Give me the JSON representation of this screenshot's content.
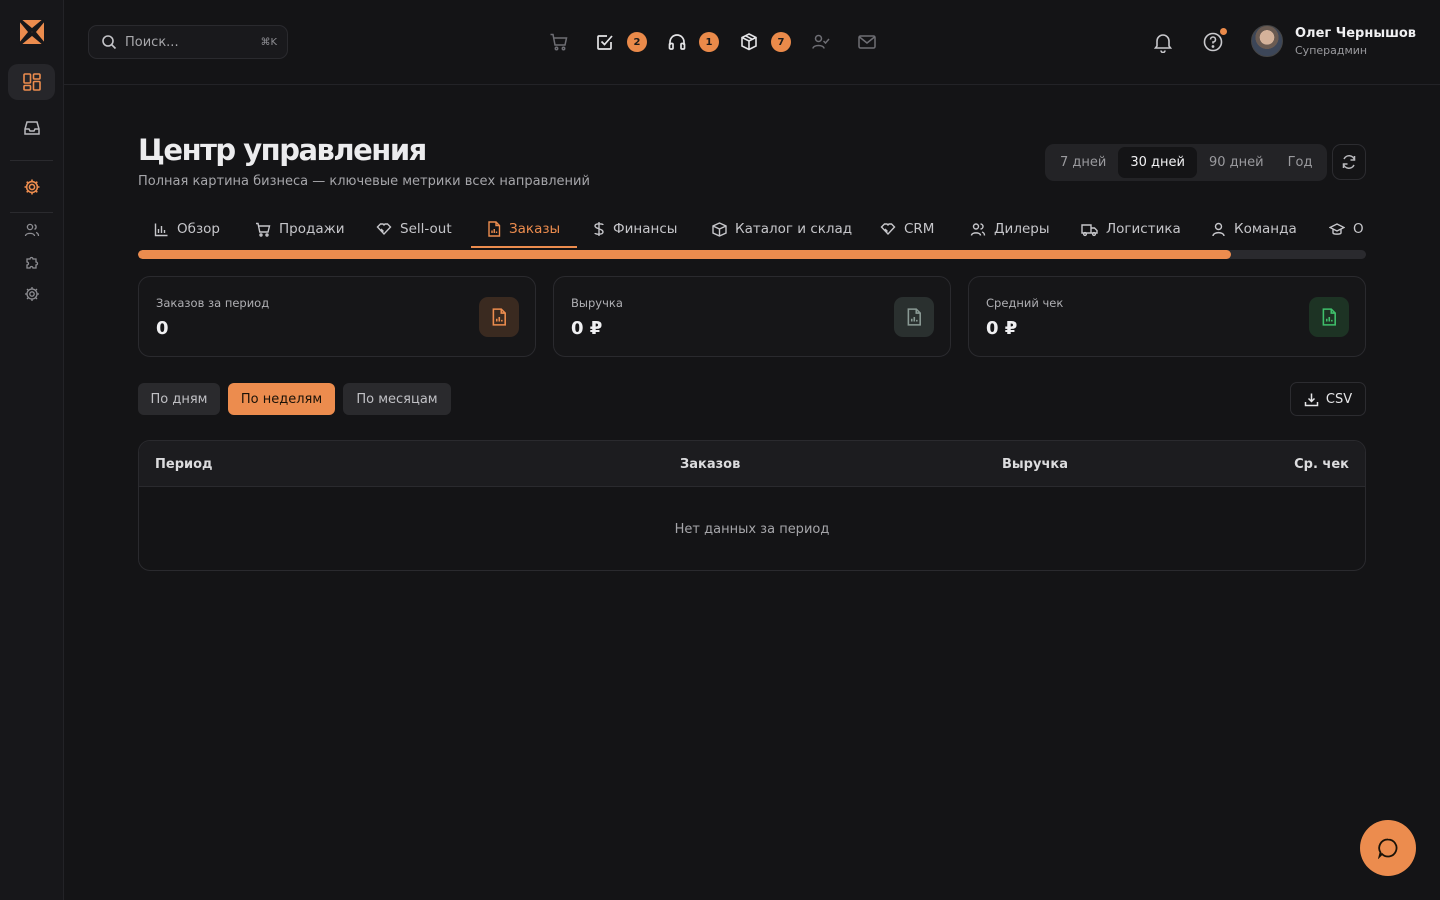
{
  "colors": {
    "accent": "#ec8c4e",
    "background": "#141416",
    "sidebar": "#17171a"
  },
  "sidebar": {
    "logo": "brand-logo",
    "items": [
      {
        "name": "dashboard-icon",
        "active": true
      },
      {
        "name": "inbox-icon",
        "active": false
      },
      {
        "name": "settings-gear-icon",
        "active": false
      },
      {
        "name": "users-icon",
        "active": false
      },
      {
        "name": "puzzle-icon",
        "active": false
      },
      {
        "name": "cog-icon",
        "active": false
      }
    ]
  },
  "header": {
    "search": {
      "placeholder": "Поиск...",
      "shortcut": "⌘K"
    },
    "quick_icons": [
      {
        "name": "cart-icon",
        "badge": ""
      },
      {
        "name": "task-check-icon",
        "badge": "2"
      },
      {
        "name": "headphones-icon",
        "badge": "1"
      },
      {
        "name": "package-icon",
        "badge": "7"
      },
      {
        "name": "user-check-icon",
        "badge": ""
      },
      {
        "name": "mail-icon",
        "badge": ""
      }
    ],
    "user": {
      "name": "Олег Чернышов",
      "role": "Суперадмин"
    }
  },
  "main": {
    "title": "Центр управления",
    "subtitle": "Полная картина бизнеса — ключевые метрики всех направлений",
    "periods": [
      {
        "label": "7 дней",
        "active": false
      },
      {
        "label": "30 дней",
        "active": true
      },
      {
        "label": "90 дней",
        "active": false
      },
      {
        "label": "Год",
        "active": false
      }
    ],
    "tabs": [
      {
        "label": "Обзор",
        "icon": "bar-chart-icon"
      },
      {
        "label": "Продажи",
        "icon": "cart-icon"
      },
      {
        "label": "Sell-out",
        "icon": "handshake-icon"
      },
      {
        "label": "Заказы",
        "icon": "document-chart-icon",
        "active": true
      },
      {
        "label": "Финансы",
        "icon": "dollar-icon"
      },
      {
        "label": "Каталог и склад",
        "icon": "box-icon"
      },
      {
        "label": "CRM",
        "icon": "handshake-icon"
      },
      {
        "label": "Дилеры",
        "icon": "users-icon"
      },
      {
        "label": "Логистика",
        "icon": "truck-icon"
      },
      {
        "label": "Команда",
        "icon": "user-icon"
      },
      {
        "label": "О",
        "icon": "graduation-cap-icon"
      }
    ],
    "tab_progress": 0.89,
    "kpis": [
      {
        "label": "Заказов за период",
        "value": "0",
        "icon_color": "#ec8c4e"
      },
      {
        "label": "Выручка",
        "value": "0 ₽",
        "icon_color": "#8a9a95"
      },
      {
        "label": "Средний чек",
        "value": "0 ₽",
        "icon_color": "#3fbf6a"
      }
    ],
    "grouping": [
      {
        "label": "По дням",
        "active": false
      },
      {
        "label": "По неделям",
        "active": true
      },
      {
        "label": "По месяцам",
        "active": false
      }
    ],
    "csv_label": "CSV",
    "table": {
      "columns": [
        "Период",
        "Заказов",
        "Выручка",
        "Ср. чек"
      ],
      "empty": "Нет данных за период"
    }
  }
}
